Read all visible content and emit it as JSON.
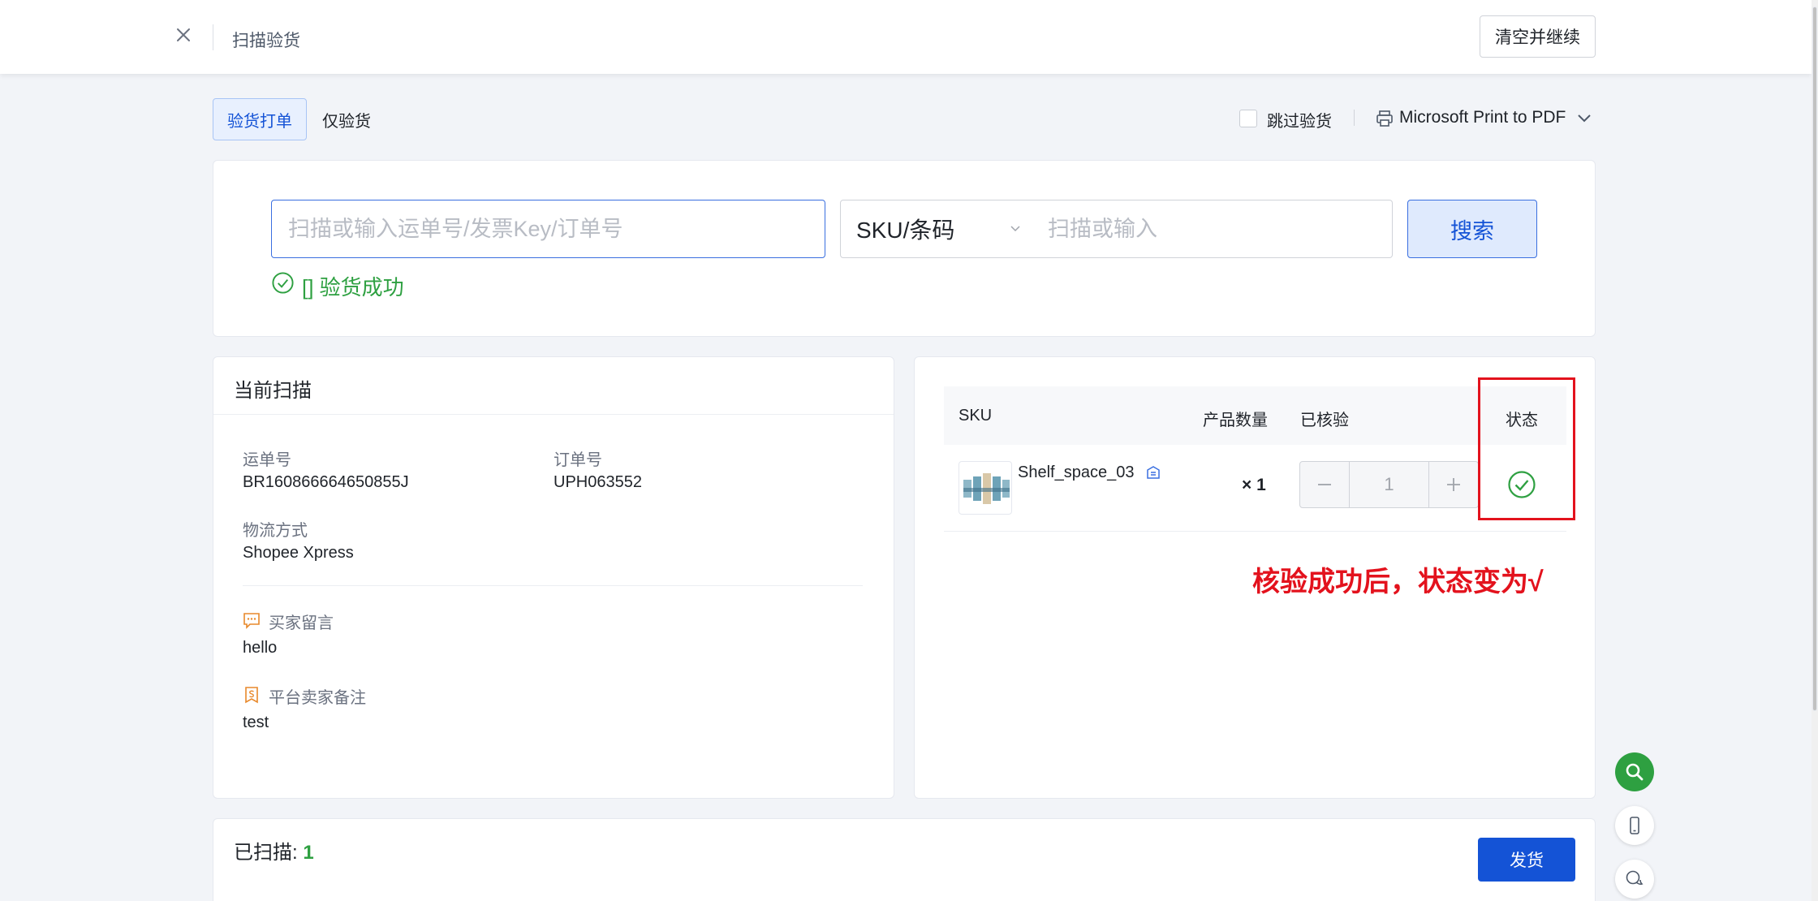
{
  "header": {
    "title": "扫描验货",
    "clear_button": "清空并继续"
  },
  "mode_tabs": [
    {
      "label": "验货打单",
      "active": true
    },
    {
      "label": "仅验货",
      "active": false
    }
  ],
  "options": {
    "skip_label": "跳过验货",
    "printer": "Microsoft Print to PDF"
  },
  "search": {
    "order_placeholder": "扫描或输入运单号/发票Key/订单号",
    "sku_type": "SKU/条码",
    "sku_placeholder": "扫描或输入",
    "button": "搜索",
    "result": "[] 验货成功"
  },
  "current_scan": {
    "title": "当前扫描",
    "tracking_label": "运单号",
    "tracking_value": "BR160866664650855J",
    "order_label": "订单号",
    "order_value": "UPH063552",
    "logistics_label": "物流方式",
    "logistics_value": "Shopee Xpress",
    "buyer_msg_label": "买家留言",
    "buyer_msg_value": "hello",
    "seller_note_label": "平台卖家备注",
    "seller_note_value": "test"
  },
  "product_table": {
    "headers": {
      "sku": "SKU",
      "qty": "产品数量",
      "checked": "已核验",
      "status": "状态"
    },
    "rows": [
      {
        "sku": "Shelf_space_03",
        "qty": "× 1",
        "checked": "1",
        "status": "verified"
      }
    ]
  },
  "annotation": "核验成功后，状态变为√",
  "footer": {
    "scanned_label": "已扫描:",
    "scanned_count": "1",
    "ship_button": "发货"
  },
  "colors": {
    "primary": "#1453d6",
    "success": "#2ea041",
    "annotation": "#e3121d"
  }
}
